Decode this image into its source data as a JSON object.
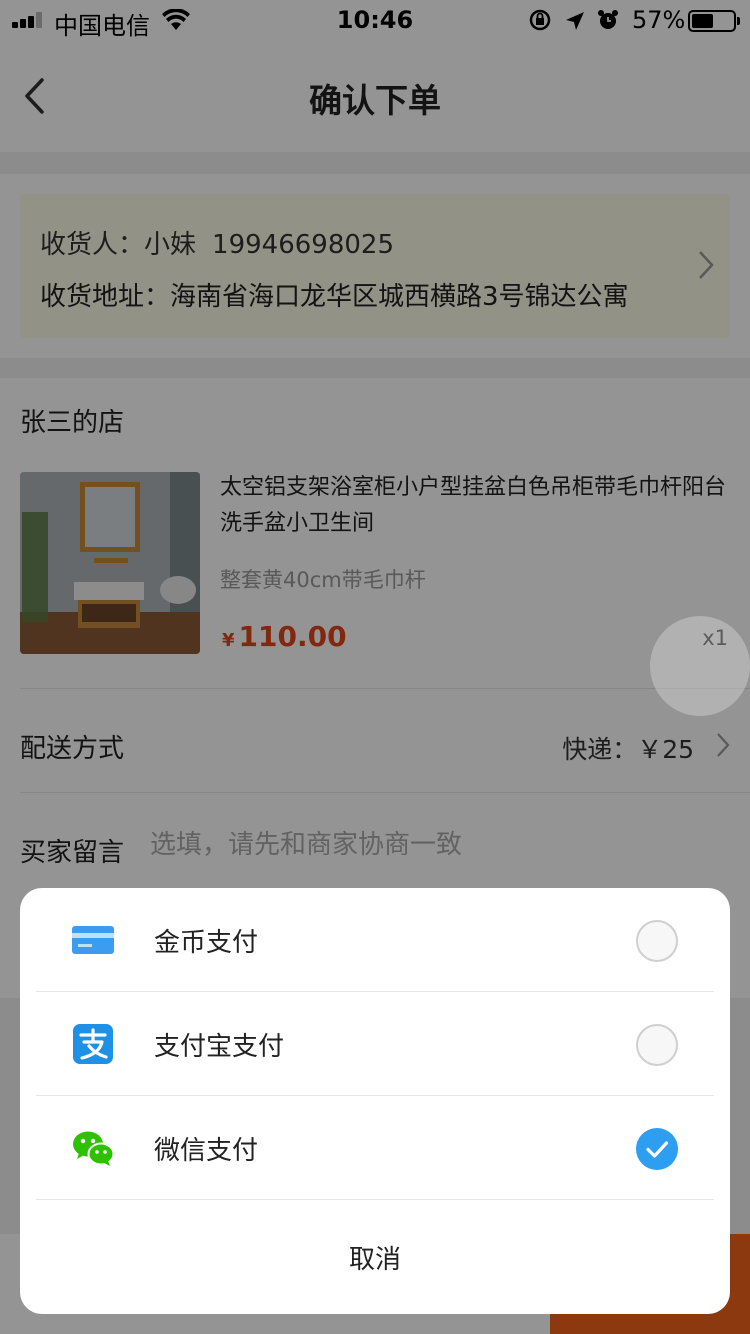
{
  "status_bar": {
    "carrier": "中国电信",
    "time": "10:46",
    "battery_percent": "57%",
    "battery_level": 0.57
  },
  "nav": {
    "title": "确认下单"
  },
  "address": {
    "receiver_label": "收货人：",
    "receiver_name": "小妹",
    "phone": "19946698025",
    "address_label": "收货地址：",
    "address_value": "海南省海口龙华区城西横路3号锦达公寓"
  },
  "shop": {
    "name": "张三的店"
  },
  "product": {
    "title": "太空铝支架浴室柜小户型挂盆白色吊柜带毛巾杆阳台洗手盆小卫生间",
    "spec": "整套黄40cm带毛巾杆",
    "price_symbol": "¥",
    "price": "110.00",
    "quantity": "x1"
  },
  "shipping": {
    "label": "配送方式",
    "value": "快递：￥25"
  },
  "message": {
    "label": "买家留言",
    "placeholder": "选填，请先和商家协商一致"
  },
  "payment_sheet": {
    "options": [
      {
        "label": "金币支付",
        "icon": "card-icon",
        "selected": false
      },
      {
        "label": "支付宝支付",
        "icon": "alipay-icon",
        "selected": false
      },
      {
        "label": "微信支付",
        "icon": "wechat-icon",
        "selected": true
      }
    ],
    "cancel_label": "取消"
  },
  "colors": {
    "accent_price": "#e0451b",
    "radio_checked": "#2d9ef0",
    "submit_orange": "#f2621c",
    "card_blue": "#3b9cf0",
    "alipay_blue": "#1e90e6",
    "wechat_green": "#2dc100"
  }
}
